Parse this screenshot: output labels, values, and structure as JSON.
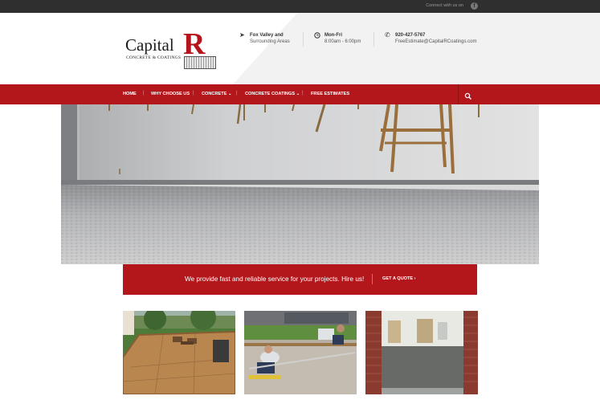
{
  "topbar": {
    "connect_text": "Connect with us on",
    "facebook_glyph": "f",
    "icon": "facebook-icon"
  },
  "logo": {
    "word": "Capital",
    "letter": "R",
    "tagline": "CONCRETE & COATINGS"
  },
  "header_info": [
    {
      "icon": "location-arrow-icon",
      "title": "Fox Valley and",
      "detail": "Surrounding Areas"
    },
    {
      "icon": "clock-icon",
      "title": "Mon-Fri",
      "detail": "8:00am - 6:00pm"
    },
    {
      "icon": "phone-icon",
      "title": "920-427-5767",
      "detail": "FreeEstimate@CapitalRCoatings.com"
    }
  ],
  "nav": {
    "items": [
      {
        "label": "HOME"
      },
      {
        "label": "WHY CHOOSE US"
      },
      {
        "label": "CONCRETE  ⌄"
      },
      {
        "label": "CONCRETE COATINGS  ⌄"
      },
      {
        "label": "FREE ESTIMATES"
      }
    ],
    "search_icon": "search-icon"
  },
  "cta": {
    "message": "We provide fast and reliable service for your projects. Hire us!",
    "button_label": "GET A QUOTE  ›"
  },
  "colors": {
    "brand_red": "#b3161b",
    "topbar": "#2f2f2f"
  }
}
